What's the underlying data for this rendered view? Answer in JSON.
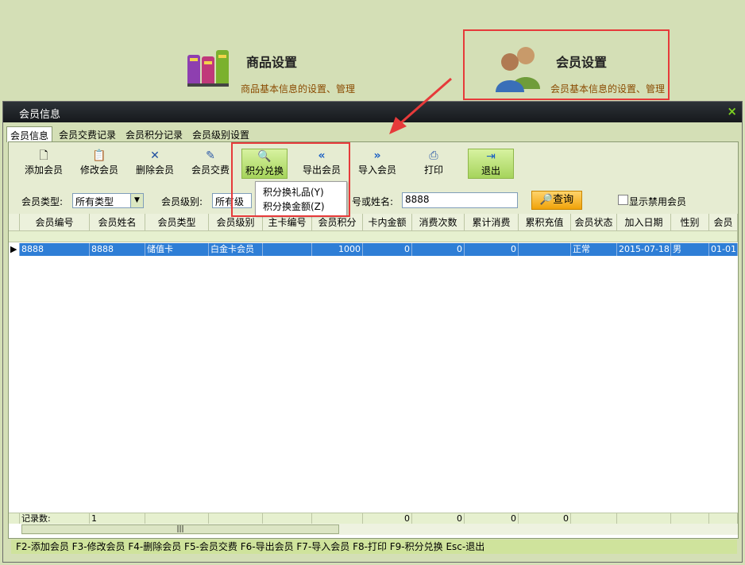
{
  "header": {
    "goods": {
      "title": "商品设置",
      "subtitle": "商品基本信息的设置、管理"
    },
    "member": {
      "title": "会员设置",
      "subtitle": "会员基本信息的设置、管理"
    }
  },
  "window": {
    "title": "会员信息",
    "close": "×"
  },
  "tabs": [
    "会员信息",
    "会员交费记录",
    "会员积分记录",
    "会员级别设置"
  ],
  "toolbar": {
    "add": "添加会员",
    "edit": "修改会员",
    "delete": "删除会员",
    "pay": "会员交费",
    "points": "积分兑换",
    "export": "导出会员",
    "import": "导入会员",
    "print": "打印",
    "exit": "退出"
  },
  "menu": {
    "gift": "积分换礼品(Y)",
    "cash": "积分换金额(Z)"
  },
  "filters": {
    "type_label": "会员类型:",
    "type_value": "所有类型",
    "level_label": "会员级别:",
    "level_value": "所有级",
    "name_label": "号或姓名:",
    "name_value": "8888",
    "query": "查询",
    "show_disabled": "显示禁用会员"
  },
  "table": {
    "columns": [
      "会员编号",
      "会员姓名",
      "会员类型",
      "会员级别",
      "主卡编号",
      "会员积分",
      "卡内金额",
      "消费次数",
      "累计消费",
      "累积充值",
      "会员状态",
      "加入日期",
      "性别",
      "会员"
    ],
    "rows": [
      [
        "8888",
        "8888",
        "储值卡",
        "白金卡会员",
        "",
        "1000",
        "0",
        "0",
        "0",
        "",
        "正常",
        "2015-07-18",
        "男",
        "01-01"
      ]
    ],
    "footer": [
      "记录数:",
      "1",
      "",
      "",
      "",
      "",
      "0",
      "0",
      "0",
      "0",
      "",
      "",
      "",
      ""
    ]
  },
  "statusbar": "F2-添加会员 F3-修改会员 F4-删除会员 F5-会员交费 F6-导出会员 F7-导入会员 F8-打印 F9-积分兑换 Esc-退出",
  "colors": {
    "highlight": "#e63a3a",
    "selected_row": "#2e7ed6",
    "background": "#d4dfb6"
  }
}
